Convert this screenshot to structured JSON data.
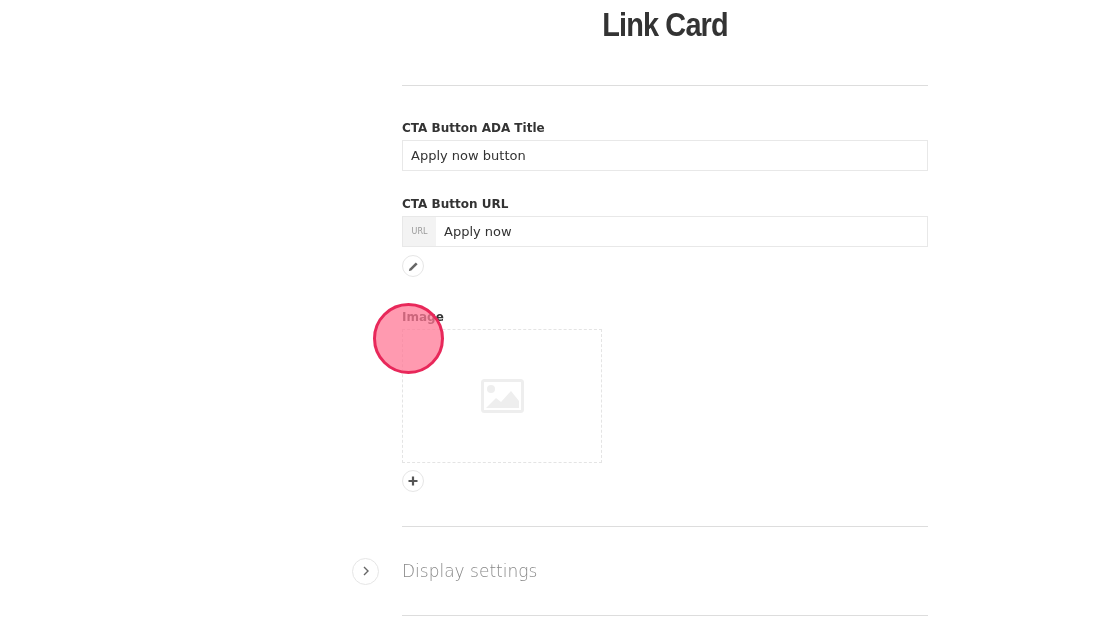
{
  "title": "Link Card",
  "fields": [
    {
      "kind": "text",
      "label": "CTA Button ADA Title",
      "value": "Apply now button"
    },
    {
      "kind": "url",
      "label": "CTA Button URL",
      "prefix": "URL",
      "value": "Apply now"
    }
  ],
  "image": {
    "label": "Image"
  },
  "display_settings": {
    "label": "Display settings",
    "expanded": false
  }
}
